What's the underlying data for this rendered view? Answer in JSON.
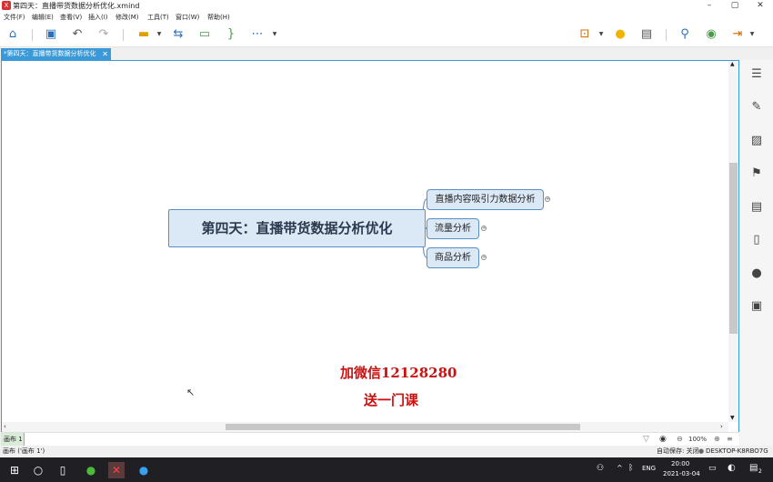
{
  "window": {
    "title": "第四天：直播带货数据分析优化.xmind",
    "controls": [
      "–",
      "▢",
      "✕"
    ]
  },
  "menu": [
    "文件(F)",
    "编辑(E)",
    "查看(V)",
    "插入(I)",
    "修改(M)",
    "工具(T)",
    "窗口(W)",
    "帮助(H)"
  ],
  "toolbar": {
    "icons": [
      "home-icon",
      "save-icon",
      "undo-icon",
      "redo-icon",
      "topic-icon",
      "relationship-icon",
      "boundary-icon",
      "summary-icon",
      "more-icon",
      "presentation-icon",
      "idea-icon",
      "outline-icon",
      "search-icon",
      "share-icon",
      "export-icon"
    ]
  },
  "tab": {
    "label": "*第四天：直播带货数据分析优化",
    "close": "✕"
  },
  "mindmap": {
    "central": "第四天：直播带货数据分析优化",
    "branches": [
      "直播内容吸引力数据分析",
      "流量分析",
      "商品分析"
    ],
    "colors": {
      "node_fill": "#dbe8f5",
      "node_border": "#5b8fc7",
      "line": "#6a98cc"
    }
  },
  "promo": {
    "line1": "加微信12128280",
    "line2": "送一门课",
    "color": "#cc1111"
  },
  "sheet": {
    "tab": "画布 1",
    "zoom": "100%"
  },
  "status": {
    "left": "画布 ('画布 1')",
    "autosave": "自动保存: 关闭",
    "computer": "DESKTOP-K8RBO7G"
  },
  "taskbar": {
    "lang": "ENG",
    "time": "20:00",
    "date": "2021-03-04",
    "notification_count": "2"
  }
}
